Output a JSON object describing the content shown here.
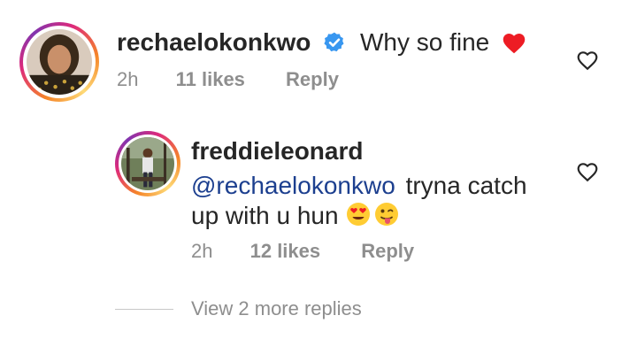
{
  "comment": {
    "username": "rechaelokonkwo",
    "verified": true,
    "text": "Why so fine",
    "trailing_icon": "red-heart-icon",
    "time": "2h",
    "likes": "11 likes",
    "reply_label": "Reply",
    "like_icon": "heart-outline-icon"
  },
  "reply": {
    "username": "freddieleonard",
    "mention": "@rechaelokonkwo",
    "text_line1": "tryna catch",
    "text_line2": "up with u hun",
    "emojis": [
      "heart-eyes-emoji-icon",
      "tongue-out-emoji-icon"
    ],
    "time": "2h",
    "likes": "12 likes",
    "reply_label": "Reply",
    "like_icon": "heart-outline-icon"
  },
  "view_more": {
    "label": "View 2 more replies"
  },
  "colors": {
    "text": "#262626",
    "meta": "#8e8e8e",
    "mention": "#1c3f8f",
    "verified": "#3897f0",
    "heart": "#ed1c24"
  }
}
